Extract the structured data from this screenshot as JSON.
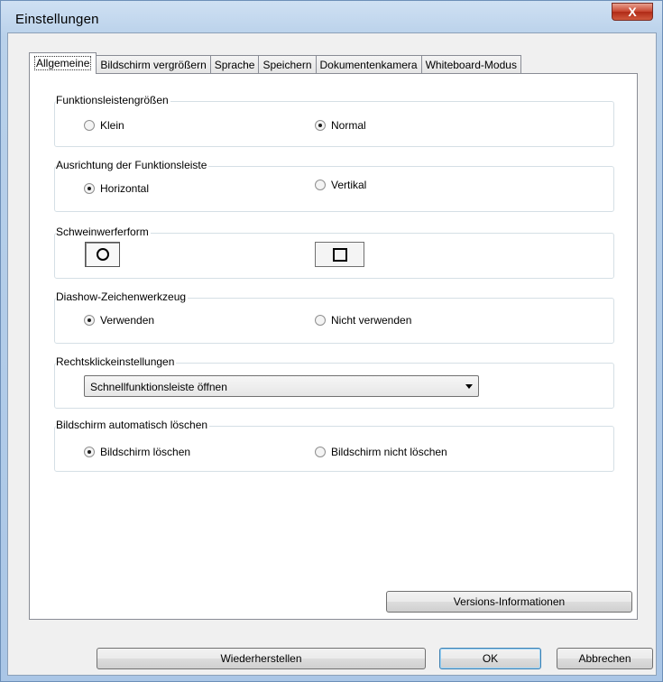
{
  "window": {
    "title": "Einstellungen",
    "close_glyph": "X"
  },
  "tabs": [
    {
      "label": "Allgemeine",
      "active": true
    },
    {
      "label": "Bildschirm vergrößern"
    },
    {
      "label": "Sprache"
    },
    {
      "label": "Speichern"
    },
    {
      "label": "Dokumentenkamera"
    },
    {
      "label": "Whiteboard-Modus"
    }
  ],
  "groups": {
    "toolbar_size": {
      "legend": "Funktionsleistengrößen",
      "option_small": "Klein",
      "option_normal": "Normal",
      "selected": "Normal"
    },
    "toolbar_orientation": {
      "legend": "Ausrichtung der Funktionsleiste",
      "option_horizontal": "Horizontal",
      "option_vertical": "Vertikal",
      "selected": "Horizontal"
    },
    "spotlight_shape": {
      "legend": "Schweinwerferform",
      "shapes": [
        "circle-icon",
        "square-icon"
      ],
      "selected": "circle"
    },
    "slideshow_tool": {
      "legend": "Diashow-Zeichenwerkzeug",
      "option_use": "Verwenden",
      "option_not_use": "Nicht verwenden",
      "selected": "Verwenden"
    },
    "right_click": {
      "legend": "Rechtsklickeinstellungen",
      "dropdown_value": "Schnellfunktionsleiste öffnen"
    },
    "auto_clear": {
      "legend": "Bildschirm automatisch löschen",
      "option_clear": "Bildschirm löschen",
      "option_not_clear": "Bildschirm nicht löschen",
      "selected": "Bildschirm löschen"
    }
  },
  "buttons": {
    "version_info": "Versions-Informationen",
    "restore": "Wiederherstellen",
    "ok": "OK",
    "cancel": "Abbrechen"
  }
}
